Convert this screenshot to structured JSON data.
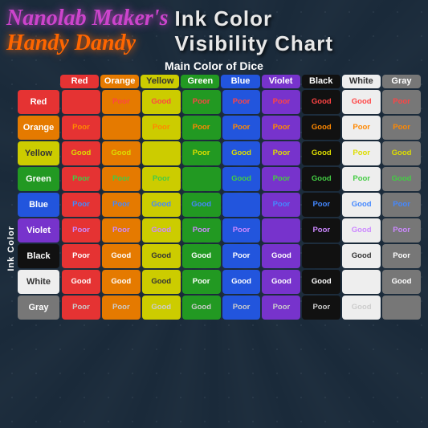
{
  "header": {
    "logo_line1": "Nanolab Maker's",
    "logo_line2": "Handy Dandy",
    "title_line1": "Ink Color",
    "title_line2": "Visibility Chart"
  },
  "subtitle": "Main Color of Dice",
  "ink_color_label": "Ink Color",
  "col_headers": [
    "Red",
    "Orange",
    "Yellow",
    "Green",
    "Blue",
    "Violet",
    "Black",
    "White",
    "Gray"
  ],
  "row_headers": [
    "Red",
    "Orange",
    "Yellow",
    "Green",
    "Blue",
    "Violet",
    "Black",
    "White",
    "Gray"
  ],
  "rows": [
    {
      "label": "Red",
      "label_class": "red-row",
      "cells": [
        {
          "text": "",
          "bg": "bg-red",
          "tc": ""
        },
        {
          "text": "Poor",
          "bg": "bg-orange",
          "tc": "text-poor-red"
        },
        {
          "text": "Good",
          "bg": "bg-yellow",
          "tc": "text-poor-red"
        },
        {
          "text": "Poor",
          "bg": "bg-green",
          "tc": "text-poor-red"
        },
        {
          "text": "Poor",
          "bg": "bg-blue",
          "tc": "text-poor-red"
        },
        {
          "text": "Poor",
          "bg": "bg-violet",
          "tc": "text-poor-red"
        },
        {
          "text": "Good",
          "bg": "bg-black",
          "tc": "text-poor-red"
        },
        {
          "text": "Good",
          "bg": "bg-white",
          "tc": "text-poor-red"
        },
        {
          "text": "Poor",
          "bg": "bg-gray",
          "tc": "text-poor-red"
        }
      ]
    },
    {
      "label": "Orange",
      "label_class": "orange-row",
      "cells": [
        {
          "text": "Poor",
          "bg": "bg-red",
          "tc": "text-poor-orange"
        },
        {
          "text": "",
          "bg": "bg-orange",
          "tc": ""
        },
        {
          "text": "Poor",
          "bg": "bg-yellow",
          "tc": "text-poor-orange"
        },
        {
          "text": "Poor",
          "bg": "bg-green",
          "tc": "text-poor-orange"
        },
        {
          "text": "Poor",
          "bg": "bg-blue",
          "tc": "text-poor-orange"
        },
        {
          "text": "Poor",
          "bg": "bg-violet",
          "tc": "text-poor-orange"
        },
        {
          "text": "Good",
          "bg": "bg-black",
          "tc": "text-poor-orange"
        },
        {
          "text": "Poor",
          "bg": "bg-white",
          "tc": "text-poor-orange"
        },
        {
          "text": "Poor",
          "bg": "bg-gray",
          "tc": "text-poor-orange"
        }
      ]
    },
    {
      "label": "Yellow",
      "label_class": "yellow-row",
      "cells": [
        {
          "text": "Good",
          "bg": "bg-red",
          "tc": "text-poor-yellow"
        },
        {
          "text": "Good",
          "bg": "bg-orange",
          "tc": "text-poor-yellow"
        },
        {
          "text": "",
          "bg": "bg-yellow",
          "tc": ""
        },
        {
          "text": "Poor",
          "bg": "bg-green",
          "tc": "text-poor-yellow"
        },
        {
          "text": "Good",
          "bg": "bg-blue",
          "tc": "text-poor-yellow"
        },
        {
          "text": "Poor",
          "bg": "bg-violet",
          "tc": "text-poor-yellow"
        },
        {
          "text": "Good",
          "bg": "bg-black",
          "tc": "text-poor-yellow"
        },
        {
          "text": "Poor",
          "bg": "bg-white",
          "tc": "text-poor-yellow"
        },
        {
          "text": "Good",
          "bg": "bg-gray",
          "tc": "text-poor-yellow"
        }
      ]
    },
    {
      "label": "Green",
      "label_class": "green-row",
      "cells": [
        {
          "text": "Poor",
          "bg": "bg-red",
          "tc": "text-poor-green"
        },
        {
          "text": "Poor",
          "bg": "bg-orange",
          "tc": "text-poor-green"
        },
        {
          "text": "Poor",
          "bg": "bg-yellow",
          "tc": "text-poor-green"
        },
        {
          "text": "",
          "bg": "bg-green",
          "tc": ""
        },
        {
          "text": "Good",
          "bg": "bg-blue",
          "tc": "text-poor-green"
        },
        {
          "text": "Poor",
          "bg": "bg-violet",
          "tc": "text-poor-green"
        },
        {
          "text": "Good",
          "bg": "bg-black",
          "tc": "text-poor-green"
        },
        {
          "text": "Poor",
          "bg": "bg-white",
          "tc": "text-poor-green"
        },
        {
          "text": "Good",
          "bg": "bg-gray",
          "tc": "text-poor-green"
        }
      ]
    },
    {
      "label": "Blue",
      "label_class": "blue-row",
      "cells": [
        {
          "text": "Poor",
          "bg": "bg-red",
          "tc": "text-poor-blue"
        },
        {
          "text": "Poor",
          "bg": "bg-orange",
          "tc": "text-poor-blue"
        },
        {
          "text": "Good",
          "bg": "bg-yellow",
          "tc": "text-poor-blue"
        },
        {
          "text": "Good",
          "bg": "bg-green",
          "tc": "text-poor-blue"
        },
        {
          "text": "",
          "bg": "bg-blue",
          "tc": ""
        },
        {
          "text": "Poor",
          "bg": "bg-violet",
          "tc": "text-poor-blue"
        },
        {
          "text": "Poor",
          "bg": "bg-black",
          "tc": "text-poor-blue"
        },
        {
          "text": "Good",
          "bg": "bg-white",
          "tc": "text-poor-blue"
        },
        {
          "text": "Poor",
          "bg": "bg-gray",
          "tc": "text-poor-blue"
        }
      ]
    },
    {
      "label": "Violet",
      "label_class": "violet-row",
      "cells": [
        {
          "text": "Poor",
          "bg": "bg-red",
          "tc": "text-poor-violet"
        },
        {
          "text": "Poor",
          "bg": "bg-orange",
          "tc": "text-poor-violet"
        },
        {
          "text": "Good",
          "bg": "bg-yellow",
          "tc": "text-poor-violet"
        },
        {
          "text": "Poor",
          "bg": "bg-green",
          "tc": "text-poor-violet"
        },
        {
          "text": "Poor",
          "bg": "bg-blue",
          "tc": "text-poor-violet"
        },
        {
          "text": "",
          "bg": "bg-violet",
          "tc": ""
        },
        {
          "text": "Poor",
          "bg": "bg-black",
          "tc": "text-poor-violet"
        },
        {
          "text": "Good",
          "bg": "bg-white",
          "tc": "text-poor-violet"
        },
        {
          "text": "Poor",
          "bg": "bg-gray",
          "tc": "text-poor-violet"
        }
      ]
    },
    {
      "label": "Black",
      "label_class": "black-row",
      "cells": [
        {
          "text": "Poor",
          "bg": "bg-red",
          "tc": "text-white-on-dark"
        },
        {
          "text": "Good",
          "bg": "bg-orange",
          "tc": "text-white-on-dark"
        },
        {
          "text": "Good",
          "bg": "bg-yellow",
          "tc": "text-dark-on-light"
        },
        {
          "text": "Good",
          "bg": "bg-green",
          "tc": "text-white-on-dark"
        },
        {
          "text": "Poor",
          "bg": "bg-blue",
          "tc": "text-white-on-dark"
        },
        {
          "text": "Good",
          "bg": "bg-violet",
          "tc": "text-white-on-dark"
        },
        {
          "text": "",
          "bg": "bg-black",
          "tc": ""
        },
        {
          "text": "Good",
          "bg": "bg-white",
          "tc": "text-dark-on-light"
        },
        {
          "text": "Poor",
          "bg": "bg-gray",
          "tc": "text-white-on-dark"
        }
      ]
    },
    {
      "label": "White",
      "label_class": "white-row",
      "cells": [
        {
          "text": "Good",
          "bg": "bg-red",
          "tc": "text-good-white"
        },
        {
          "text": "Good",
          "bg": "bg-orange",
          "tc": "text-good-white"
        },
        {
          "text": "Good",
          "bg": "bg-yellow",
          "tc": "text-dark-on-light"
        },
        {
          "text": "Poor",
          "bg": "bg-green",
          "tc": "text-good-white"
        },
        {
          "text": "Good",
          "bg": "bg-blue",
          "tc": "text-good-white"
        },
        {
          "text": "Good",
          "bg": "bg-violet",
          "tc": "text-good-white"
        },
        {
          "text": "Good",
          "bg": "bg-black",
          "tc": "text-good-white"
        },
        {
          "text": "",
          "bg": "bg-white",
          "tc": ""
        },
        {
          "text": "Good",
          "bg": "bg-gray",
          "tc": "text-good-white"
        }
      ]
    },
    {
      "label": "Gray",
      "label_class": "gray-row",
      "cells": [
        {
          "text": "Poor",
          "bg": "bg-red",
          "tc": "text-poor-gray"
        },
        {
          "text": "Poor",
          "bg": "bg-orange",
          "tc": "text-poor-gray"
        },
        {
          "text": "Good",
          "bg": "bg-yellow",
          "tc": "text-poor-gray"
        },
        {
          "text": "Good",
          "bg": "bg-green",
          "tc": "text-poor-gray"
        },
        {
          "text": "Poor",
          "bg": "bg-blue",
          "tc": "text-poor-gray"
        },
        {
          "text": "Poor",
          "bg": "bg-violet",
          "tc": "text-poor-gray"
        },
        {
          "text": "Poor",
          "bg": "bg-black",
          "tc": "text-poor-gray"
        },
        {
          "text": "Good",
          "bg": "bg-white",
          "tc": "text-poor-gray"
        },
        {
          "text": "",
          "bg": "bg-gray",
          "tc": ""
        }
      ]
    }
  ]
}
